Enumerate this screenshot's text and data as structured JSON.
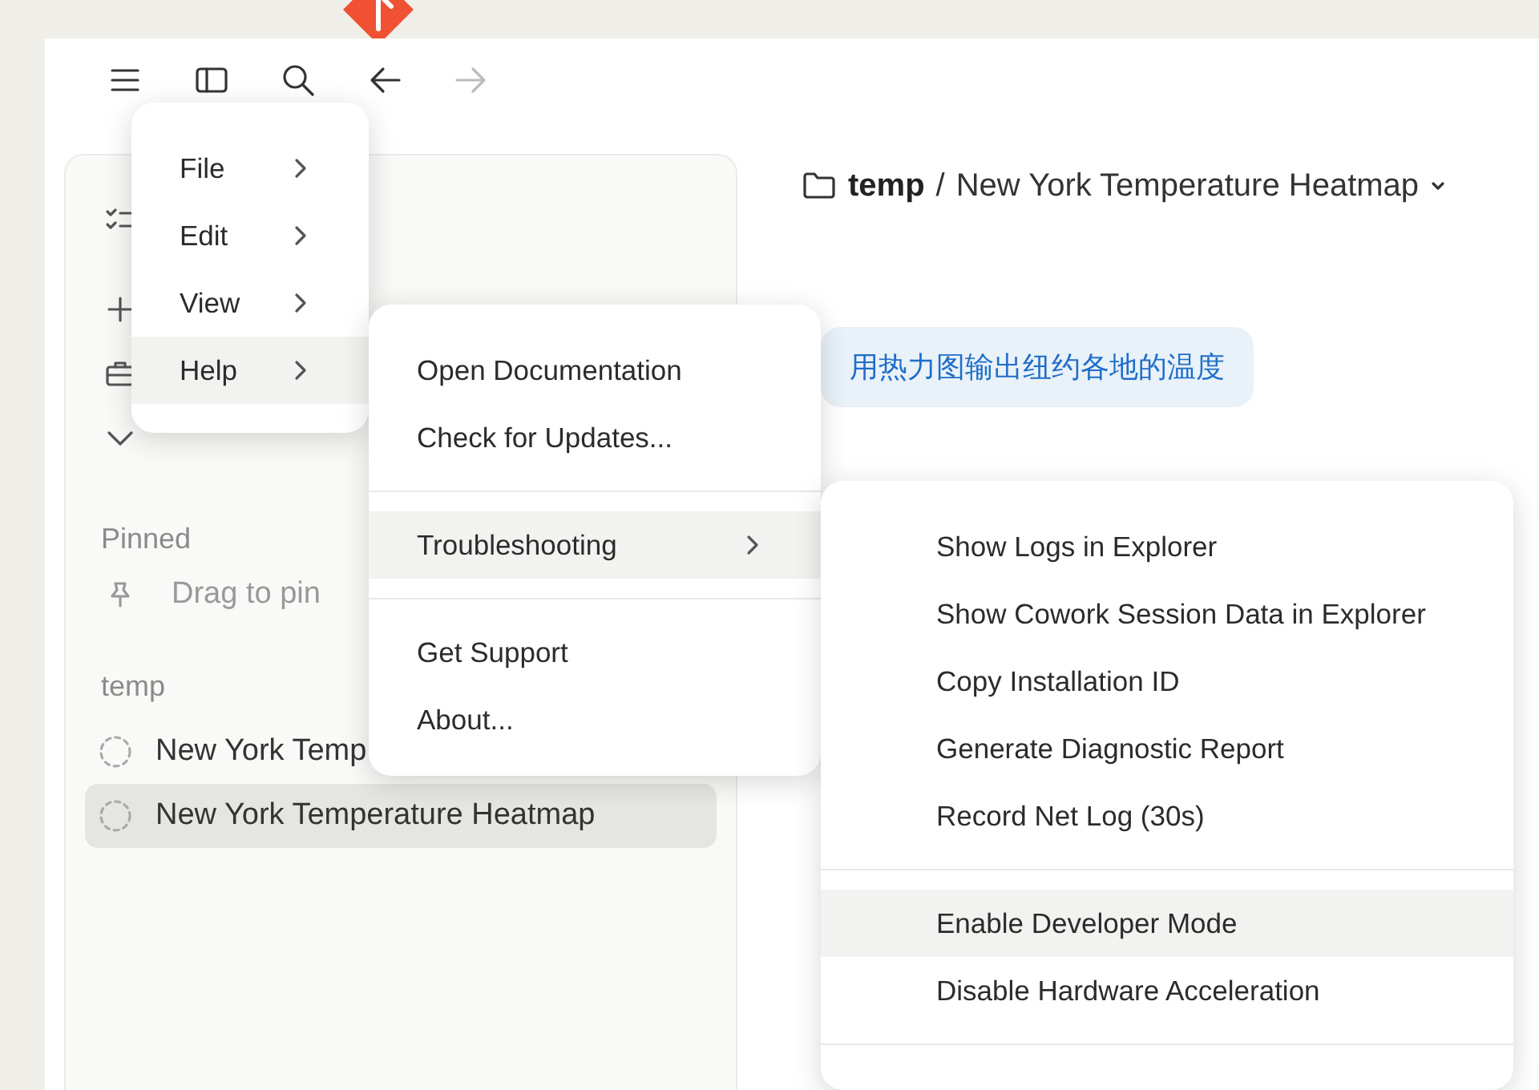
{
  "toolbar": [
    {
      "kind": "menu",
      "disabled": false
    },
    {
      "kind": "sidebar",
      "disabled": false
    },
    {
      "kind": "search",
      "disabled": false
    },
    {
      "kind": "back",
      "disabled": false
    },
    {
      "kind": "forward",
      "disabled": true
    }
  ],
  "sidebar": {
    "top_items": [
      {
        "kind": "list"
      },
      {
        "kind": "new"
      },
      {
        "kind": "projects"
      },
      {
        "kind": "more"
      }
    ],
    "pinned": {
      "heading": "Pinned",
      "hint": "Drag to pin"
    },
    "groups": [
      {
        "heading": "temp",
        "chats": [
          {
            "title": "New York Temp",
            "selected": false
          },
          {
            "title": "New York Temperature Heatmap",
            "selected": true
          }
        ]
      }
    ]
  },
  "breadcrumb": {
    "folder": "temp",
    "separator": "/",
    "title": "New York Temperature Heatmap"
  },
  "messages": [
    {
      "text": "用热力图输出纽约各地的温度"
    }
  ],
  "menus": [
    {
      "items": [
        {
          "kind": "item",
          "label": "File",
          "submenu": true,
          "selected": false
        },
        {
          "kind": "item",
          "label": "Edit",
          "submenu": true,
          "selected": false
        },
        {
          "kind": "item",
          "label": "View",
          "submenu": true,
          "selected": false
        },
        {
          "kind": "item",
          "label": "Help",
          "submenu": true,
          "selected": true
        }
      ]
    },
    {
      "items": [
        {
          "kind": "item",
          "label": "Open Documentation",
          "submenu": false,
          "selected": false
        },
        {
          "kind": "item",
          "label": "Check for Updates...",
          "submenu": false,
          "selected": false
        },
        {
          "kind": "divider"
        },
        {
          "kind": "item",
          "label": "Troubleshooting",
          "submenu": true,
          "selected": true
        },
        {
          "kind": "divider"
        },
        {
          "kind": "item",
          "label": "Get Support",
          "submenu": false,
          "selected": false
        },
        {
          "kind": "item",
          "label": "About...",
          "submenu": false,
          "selected": false
        }
      ]
    },
    {
      "items": [
        {
          "kind": "item",
          "label": "Show Logs in Explorer",
          "submenu": false,
          "selected": false
        },
        {
          "kind": "item",
          "label": "Show Cowork Session Data in Explorer",
          "submenu": false,
          "selected": false
        },
        {
          "kind": "item",
          "label": "Copy Installation ID",
          "submenu": false,
          "selected": false
        },
        {
          "kind": "item",
          "label": "Generate Diagnostic Report",
          "submenu": false,
          "selected": false
        },
        {
          "kind": "item",
          "label": "Record Net Log (30s)",
          "submenu": false,
          "selected": false
        },
        {
          "kind": "divider"
        },
        {
          "kind": "item",
          "label": "Enable Developer Mode",
          "submenu": false,
          "selected": true
        },
        {
          "kind": "item",
          "label": "Disable Hardware Acceleration",
          "submenu": false,
          "selected": false
        },
        {
          "kind": "divider"
        }
      ]
    }
  ]
}
